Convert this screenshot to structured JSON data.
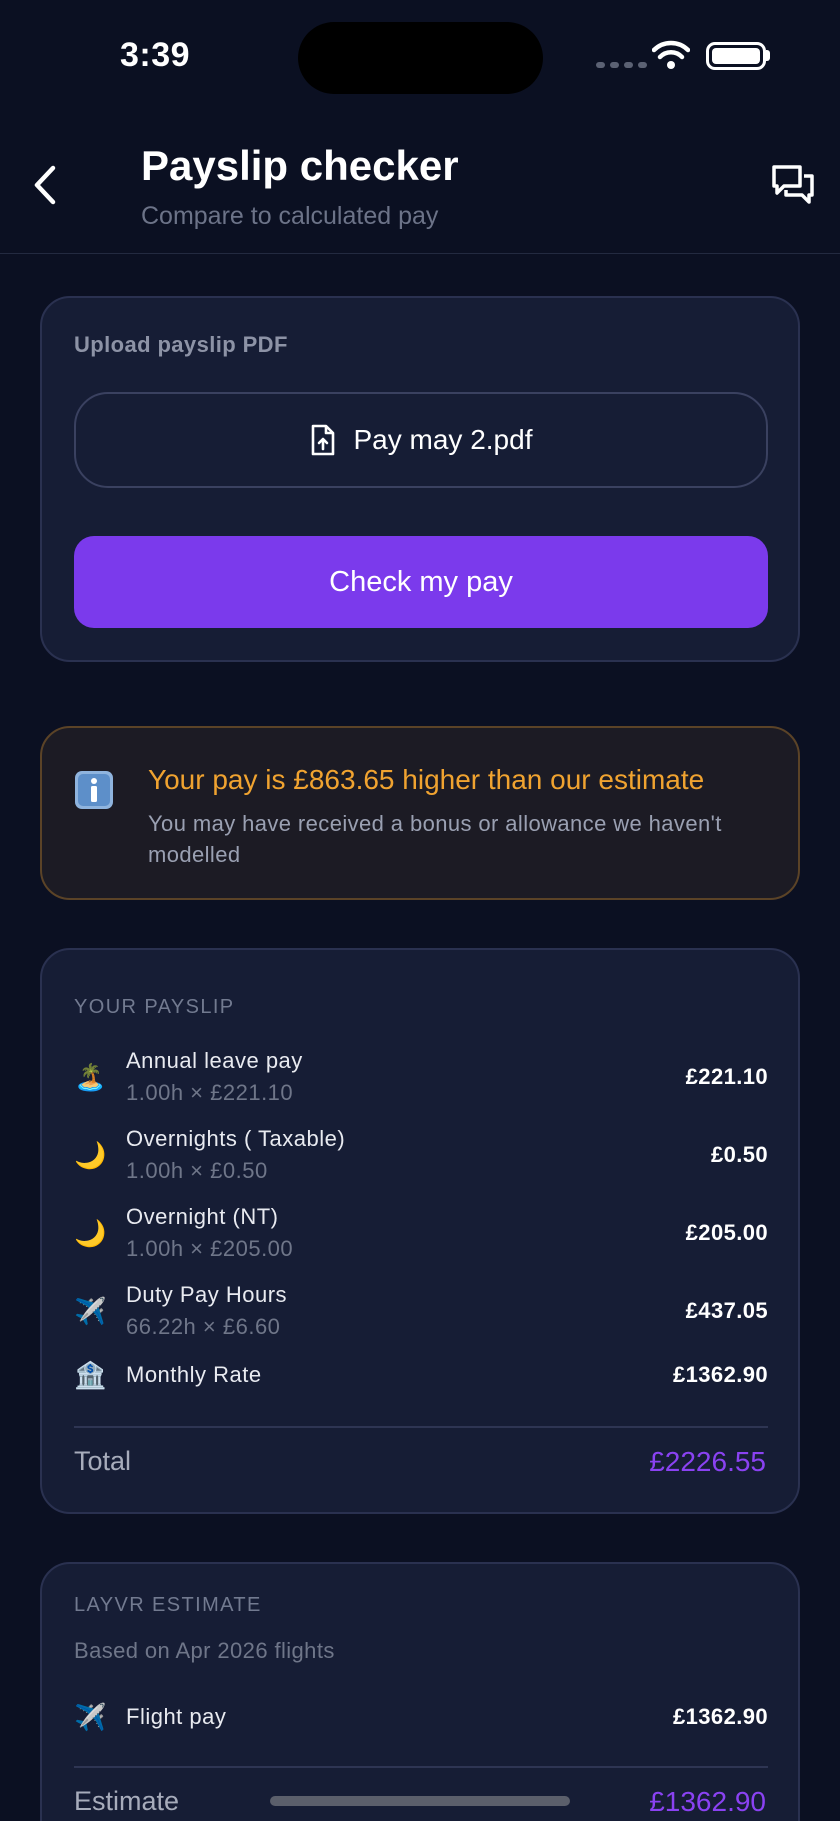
{
  "status_bar": {
    "time": "3:39"
  },
  "header": {
    "title": "Payslip checker",
    "subtitle": "Compare to calculated pay",
    "back_icon": "chevron-left-icon",
    "chat_icon": "chat-bubbles-icon"
  },
  "upload": {
    "label": "Upload payslip PDF",
    "file_name": "Pay may 2.pdf",
    "file_icon": "file-upload-icon",
    "check_button": "Check my pay"
  },
  "alert": {
    "icon": "info-icon",
    "title": "Your pay is £863.65 higher than our estimate",
    "text": "You may have received a bonus or allowance we haven't modelled"
  },
  "payslip": {
    "section_label": "YOUR PAYSLIP",
    "items": [
      {
        "icon": "🏝️",
        "name": "Annual leave pay",
        "detail": "1.00h × £221.10",
        "amount": "£221.10"
      },
      {
        "icon": "🌙",
        "name": "Overnights ( Taxable)",
        "detail": "1.00h × £0.50",
        "amount": "£0.50"
      },
      {
        "icon": "🌙",
        "name": "Overnight (NT)",
        "detail": "1.00h × £205.00",
        "amount": "£205.00"
      },
      {
        "icon": "✈️",
        "name": "Duty Pay Hours",
        "detail": "66.22h × £6.60",
        "amount": "£437.05"
      },
      {
        "icon": "🏦",
        "name": "Monthly Rate",
        "detail": "",
        "amount": "£1362.90"
      }
    ],
    "total_label": "Total",
    "total_amount": "£2226.55"
  },
  "estimate": {
    "section_label": "LAYVR ESTIMATE",
    "subtitle": "Based on Apr 2026 flights",
    "items": [
      {
        "icon": "✈️",
        "name": "Flight pay",
        "amount": "£1362.90"
      }
    ],
    "total_label": "Estimate",
    "total_amount": "£1362.90"
  },
  "colors": {
    "background": "#0b1022",
    "card": "#161d35",
    "accent_purple": "#7b3aec",
    "warning_orange": "#f0a330"
  }
}
